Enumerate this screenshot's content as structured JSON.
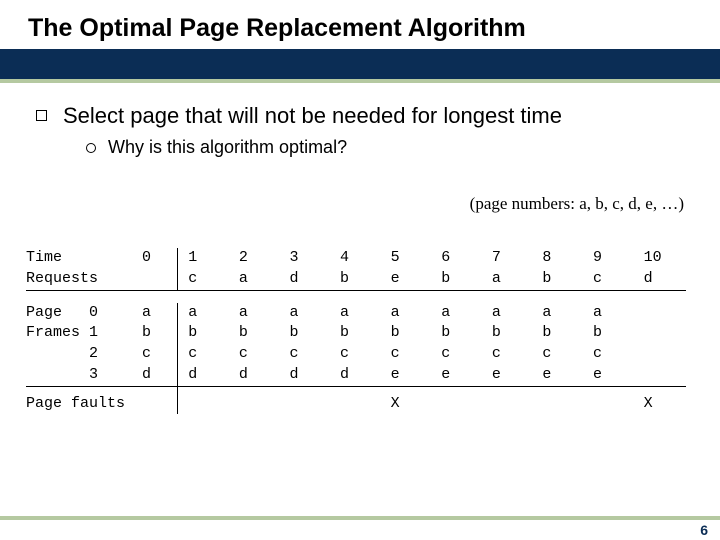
{
  "title": "The Optimal Page Replacement Algorithm",
  "bullet1": "Select page that will not be needed for longest time",
  "subbullet1": "Why is this algorithm optimal?",
  "page_numbers_note": "(page numbers: a, b, c, d, e, …)",
  "tbl": {
    "time_label": "Time",
    "requests_label": "Requests",
    "page_label": "Page",
    "frames_label": "Frames",
    "faults_label": "Page faults",
    "frame_idx": [
      "0",
      "1",
      "2",
      "3"
    ],
    "time": [
      "0",
      "1",
      "2",
      "3",
      "4",
      "5",
      "6",
      "7",
      "8",
      "9",
      "10"
    ],
    "requests": [
      "",
      "c",
      "a",
      "d",
      "b",
      "e",
      "b",
      "a",
      "b",
      "c",
      "d"
    ],
    "initial_frames": [
      "a",
      "b",
      "c",
      "d"
    ],
    "frames": [
      [
        "a",
        "a",
        "a",
        "a",
        "a",
        "a",
        "a",
        "a",
        "a"
      ],
      [
        "b",
        "b",
        "b",
        "b",
        "b",
        "b",
        "b",
        "b",
        "b"
      ],
      [
        "c",
        "c",
        "c",
        "c",
        "c",
        "c",
        "c",
        "c",
        "c"
      ],
      [
        "d",
        "d",
        "d",
        "d",
        "e",
        "e",
        "e",
        "e",
        "e"
      ]
    ],
    "faults_marks": [
      "",
      "",
      "",
      "",
      "X",
      "",
      "",
      "",
      "",
      "X"
    ]
  },
  "page_number": "6"
}
